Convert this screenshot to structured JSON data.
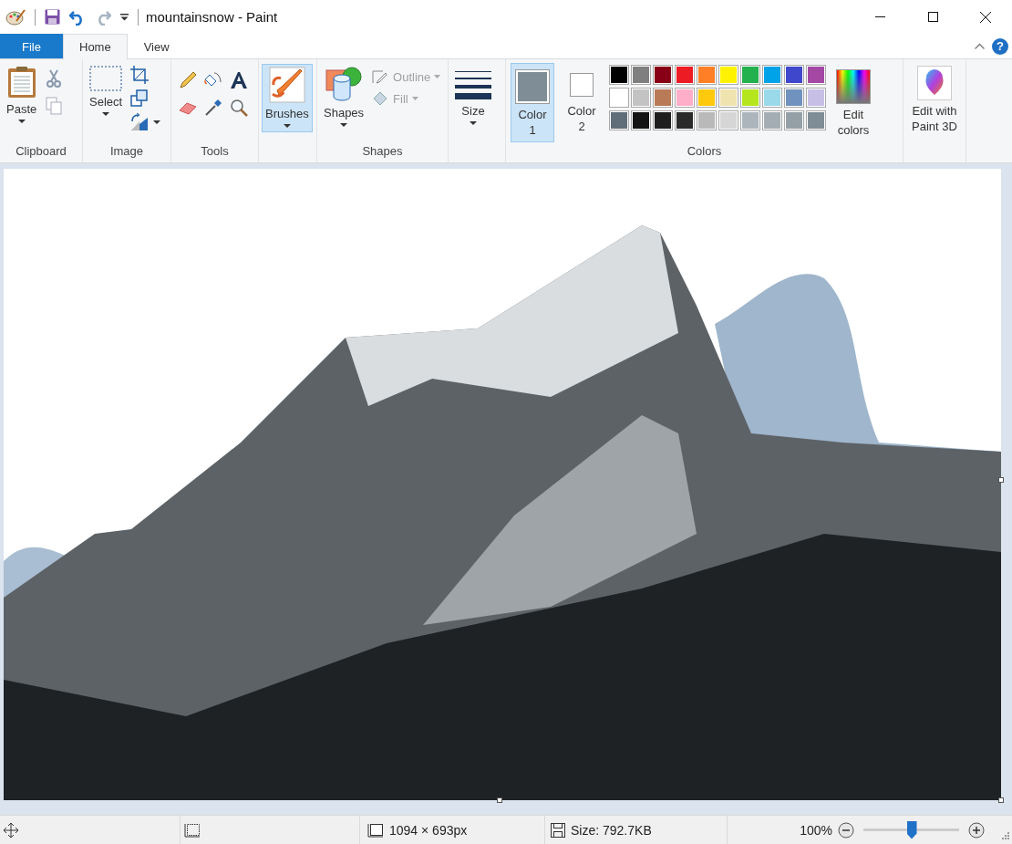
{
  "window": {
    "title": "mountainsnow - Paint"
  },
  "tabs": [
    {
      "label": "File",
      "kind": "file",
      "selected": false
    },
    {
      "label": "Home",
      "kind": "tab",
      "selected": true
    },
    {
      "label": "View",
      "kind": "tab",
      "selected": false
    }
  ],
  "help": "?",
  "ribbon": {
    "clipboard": {
      "label": "Clipboard",
      "paste": "Paste"
    },
    "image": {
      "label": "Image",
      "select": "Select"
    },
    "tools": {
      "label": "Tools"
    },
    "brushes": {
      "label": "Brushes",
      "selected": true
    },
    "shapes": {
      "label": "Shapes",
      "button": "Shapes",
      "outline": {
        "label": "Outline",
        "disabled": true
      },
      "fill": {
        "label": "Fill",
        "disabled": true
      }
    },
    "size": {
      "label": "Size"
    },
    "colors": {
      "label": "Colors",
      "color1": {
        "label": "Color 1",
        "color": "#7f8d96",
        "selected": true
      },
      "color2": {
        "label": "Color 2",
        "color": "#ffffff",
        "selected": false
      },
      "palette": [
        {
          "color": "#000000"
        },
        {
          "color": "#7f7f7f"
        },
        {
          "color": "#880015"
        },
        {
          "color": "#ed1c24"
        },
        {
          "color": "#ff7f27"
        },
        {
          "color": "#fff200"
        },
        {
          "color": "#22b14c"
        },
        {
          "color": "#00a2e8"
        },
        {
          "color": "#3f48cc"
        },
        {
          "color": "#a349a4"
        },
        {
          "color": "#ffffff"
        },
        {
          "color": "#c3c3c3"
        },
        {
          "color": "#b97a57"
        },
        {
          "color": "#ffaec9"
        },
        {
          "color": "#ffc90e"
        },
        {
          "color": "#efe4b0"
        },
        {
          "color": "#b5e61d"
        },
        {
          "color": "#99d9ea"
        },
        {
          "color": "#7092be"
        },
        {
          "color": "#c8bfe7"
        },
        {
          "color": "#5f6e78"
        },
        {
          "color": "#141414"
        },
        {
          "color": "#1e1e1e"
        },
        {
          "color": "#2a2a2a"
        },
        {
          "color": "#b9b9b9"
        },
        {
          "color": "#d6d6d6"
        },
        {
          "color": "#adb5bc"
        },
        {
          "color": "#a3adb3"
        },
        {
          "color": "#949fa6"
        },
        {
          "color": "#7f8d96"
        }
      ],
      "edit": "Edit colors"
    },
    "paint3d": "Edit with Paint 3D"
  },
  "status_bar": {
    "dimensions": "1094 × 693px",
    "file_size": "Size: 792.7KB",
    "zoom": {
      "label": "100%",
      "level": 0.5
    }
  }
}
